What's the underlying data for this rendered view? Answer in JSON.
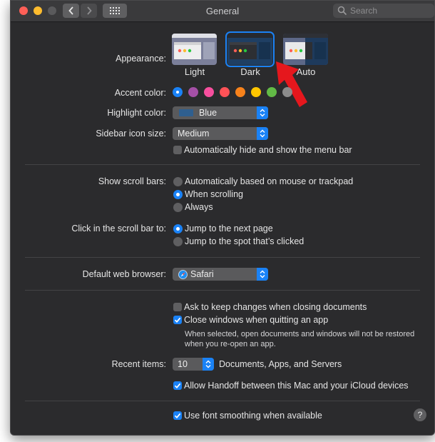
{
  "window": {
    "title": "General"
  },
  "search": {
    "placeholder": "Search"
  },
  "appearance": {
    "label": "Appearance:",
    "options": [
      "Light",
      "Dark",
      "Auto"
    ],
    "selected": "Dark"
  },
  "accent": {
    "label": "Accent color:",
    "colors": [
      "#1a82f6",
      "#a550a7",
      "#f74f9e",
      "#ff5257",
      "#f7821b",
      "#ffc600",
      "#62ba46",
      "#8c8c8c"
    ],
    "selected_index": 0
  },
  "highlight": {
    "label": "Highlight color:",
    "value": "Blue",
    "swatch": "#2f5f8f"
  },
  "sidebar_icon": {
    "label": "Sidebar icon size:",
    "value": "Medium"
  },
  "menu_bar": {
    "label": "Automatically hide and show the menu bar",
    "checked": false
  },
  "scroll_bars": {
    "label": "Show scroll bars:",
    "options": [
      "Automatically based on mouse or trackpad",
      "When scrolling",
      "Always"
    ],
    "selected": "When scrolling"
  },
  "click_scroll": {
    "label": "Click in the scroll bar to:",
    "options": [
      "Jump to the next page",
      "Jump to the spot that’s clicked"
    ],
    "selected": "Jump to the next page"
  },
  "browser": {
    "label": "Default web browser:",
    "value": "Safari"
  },
  "ask_keep": {
    "label": "Ask to keep changes when closing documents",
    "checked": false
  },
  "close_windows": {
    "label": "Close windows when quitting an app",
    "checked": true,
    "note_line1": "When selected, open documents and windows will not be restored",
    "note_line2": "when you re-open an app."
  },
  "recent": {
    "label": "Recent items:",
    "value": "10",
    "suffix": "Documents, Apps, and Servers"
  },
  "handoff": {
    "label": "Allow Handoff between this Mac and your iCloud devices",
    "checked": true
  },
  "font_smoothing": {
    "label": "Use font smoothing when available",
    "checked": true
  },
  "help": {
    "label": "?"
  }
}
